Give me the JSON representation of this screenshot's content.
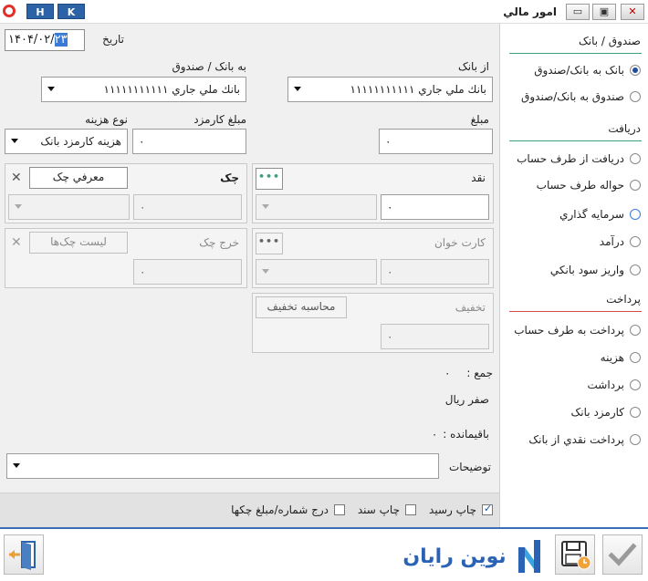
{
  "title_bar": {
    "title": "امور مالي",
    "h_label": "H",
    "k_label": "K",
    "minimize_glyph": "▭",
    "restore_glyph": "▣",
    "close_glyph": "✕"
  },
  "date": {
    "label": "تاريخ",
    "value_prefix": "۱۴۰۴/۰۲/",
    "value_selected": "۲۳"
  },
  "from_bank": {
    "label": "از بانک",
    "value": "بانك ملي جاري ۱۱۱۱۱۱۱۱۱۱۱"
  },
  "to_bank": {
    "label": "به بانک / صندوق",
    "value": "بانك ملي جاري ۱۱۱۱۱۱۱۱۱۱۱"
  },
  "amount": {
    "label": "مبلغ",
    "value": "۰"
  },
  "fee_amount": {
    "label": "مبلغ کارمزد",
    "value": "۰"
  },
  "fee_type": {
    "label": "نوع هزينه",
    "value": "هزينه کارمزد بانک"
  },
  "cash": {
    "label": "نقد",
    "value": "۰",
    "dots": "•••"
  },
  "cheque": {
    "label": "چک",
    "button": "معرفي چک",
    "value": "۰",
    "close": "✕"
  },
  "card_reader": {
    "label": "کارت خوان",
    "value": "۰",
    "dots": "•••"
  },
  "cheque_out": {
    "label": "خرج چک",
    "button": "ليست چک‌ها",
    "value": "۰",
    "close": "✕"
  },
  "discount": {
    "label": "تخفيف",
    "button": "محاسبه تخفيف",
    "value": "۰"
  },
  "total": {
    "label": "جمع :",
    "value": "۰",
    "words": "صفر ريال"
  },
  "remainder": {
    "label": "باقيمانده :",
    "value": "۰"
  },
  "description": {
    "label": "توضيحات",
    "value": ""
  },
  "print_options": [
    {
      "label": "چاپ رسيد",
      "checked": true
    },
    {
      "label": "چاپ سند",
      "checked": false
    },
    {
      "label": "درج شماره/مبلغ چکها",
      "checked": false
    }
  ],
  "sidebar": {
    "section_cash_bank": "صندوق / بانک",
    "cash_bank_items": [
      {
        "label": "بانک به بانک/صندوق",
        "selected": true
      },
      {
        "label": "صندوق به بانک/صندوق",
        "selected": false
      }
    ],
    "section_receive": "دريافت",
    "receive_items": [
      {
        "label": "دريافت از طرف حساب",
        "selected": false
      },
      {
        "label": "حواله طرف حساب",
        "selected": false
      },
      {
        "label": "سرمايه گذاري",
        "selected": false
      },
      {
        "label": "درآمد",
        "selected": false
      },
      {
        "label": "واريز سود بانکي",
        "selected": false
      }
    ],
    "section_payment": "پرداخت",
    "payment_items": [
      {
        "label": "پرداخت به طرف حساب",
        "selected": false
      },
      {
        "label": "هزينه",
        "selected": false
      },
      {
        "label": "برداشت",
        "selected": false
      },
      {
        "label": "کارمزد بانک",
        "selected": false
      },
      {
        "label": "پرداخت نقدي از بانک",
        "selected": false
      }
    ]
  },
  "footer": {
    "brand_text": "نوين رايان",
    "exit_icon": "exit-door-icon",
    "save_icon": "floppy-clock-icon",
    "confirm_icon": "checkmark-icon",
    "accent_color": "#2a62b5"
  }
}
